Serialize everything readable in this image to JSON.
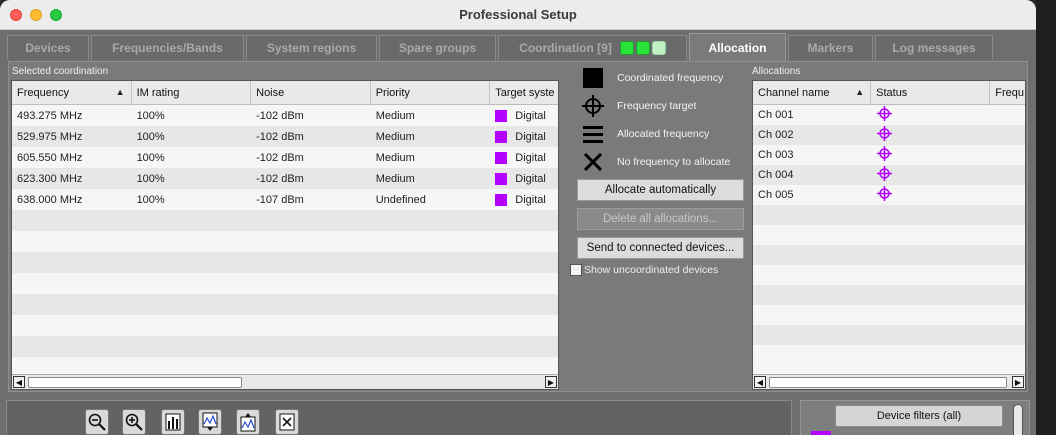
{
  "window": {
    "title": "Professional Setup"
  },
  "tabs": [
    {
      "label": "Devices"
    },
    {
      "label": "Frequencies/Bands"
    },
    {
      "label": "System regions"
    },
    {
      "label": "Spare groups"
    },
    {
      "label": "Coordination [9]"
    },
    {
      "label": "Allocation",
      "active": true
    },
    {
      "label": "Markers"
    },
    {
      "label": "Log messages"
    }
  ],
  "selected_coordination": {
    "label": "Selected coordination",
    "columns": [
      "Frequency",
      "IM rating",
      "Noise",
      "Priority",
      "Target syste"
    ],
    "rows": [
      {
        "frequency": "493.275 MHz",
        "im": "100%",
        "noise": "-102 dBm",
        "priority": "Medium",
        "target": "Digital"
      },
      {
        "frequency": "529.975 MHz",
        "im": "100%",
        "noise": "-102 dBm",
        "priority": "Medium",
        "target": "Digital"
      },
      {
        "frequency": "605.550 MHz",
        "im": "100%",
        "noise": "-102 dBm",
        "priority": "Medium",
        "target": "Digital"
      },
      {
        "frequency": "623.300 MHz",
        "im": "100%",
        "noise": "-102 dBm",
        "priority": "Medium",
        "target": "Digital"
      },
      {
        "frequency": "638.000 MHz",
        "im": "100%",
        "noise": "-107 dBm",
        "priority": "Undefined",
        "target": "Digital"
      }
    ],
    "target_color": "#b300ff"
  },
  "legend": {
    "coordinated": "Coordinated frequency",
    "target": "Frequency target",
    "allocated": "Allocated frequency",
    "none": "No frequency to allocate"
  },
  "actions": {
    "allocate": "Allocate automatically",
    "delete": "Delete all allocations...",
    "send": "Send to connected devices...",
    "show_uncoordinated": "Show uncoordinated devices"
  },
  "allocations": {
    "label": "Allocations",
    "columns": [
      "Channel name",
      "Status",
      "Frequ"
    ],
    "rows": [
      {
        "channel": "Ch 001",
        "status": "frequency-target-icon"
      },
      {
        "channel": "Ch 002",
        "status": "frequency-target-icon"
      },
      {
        "channel": "Ch 003",
        "status": "frequency-target-icon"
      },
      {
        "channel": "Ch 004",
        "status": "frequency-target-icon"
      },
      {
        "channel": "Ch 005",
        "status": "frequency-target-icon"
      }
    ],
    "status_color": "#b300ff"
  },
  "device_filters": {
    "label": "Device filters (all)"
  },
  "toolbar_icons": [
    "zoom-out-icon",
    "zoom-in-icon",
    "bar-chart-icon",
    "spectrum-down-icon",
    "spectrum-up-icon",
    "clear-icon"
  ]
}
